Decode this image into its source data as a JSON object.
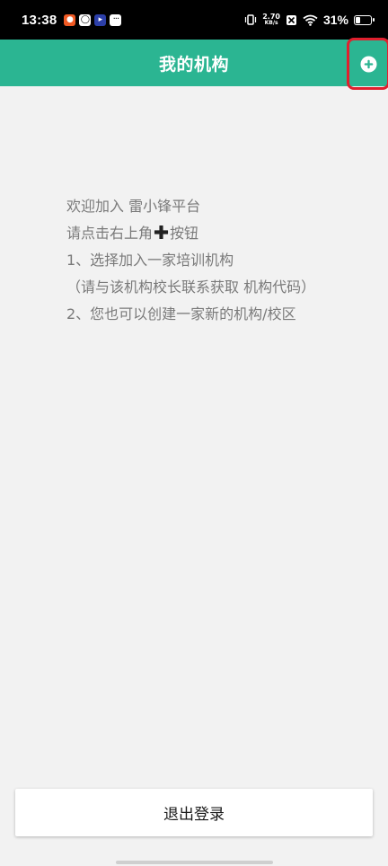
{
  "status_bar": {
    "time": "13:38",
    "net_speed_value": "2.70",
    "net_speed_unit": "KB/s",
    "battery_percent": "31%",
    "battery_level": 0.31
  },
  "header": {
    "title": "我的机构"
  },
  "instructions": {
    "line1": "欢迎加入 雷小锋平台",
    "line2_before": "请点击右上角",
    "line2_after": "按钮",
    "line3": "1、选择加入一家培训机构",
    "line4": "（请与该机构校长联系获取 机构代码）",
    "line5": "2、您也可以创建一家新的机构/校区"
  },
  "footer": {
    "logout_label": "退出登录"
  },
  "colors": {
    "header_bg": "#2bb592",
    "highlight_border": "#e0202e",
    "page_bg": "#f2f2f2",
    "instruction_text": "#7a7a7a"
  }
}
